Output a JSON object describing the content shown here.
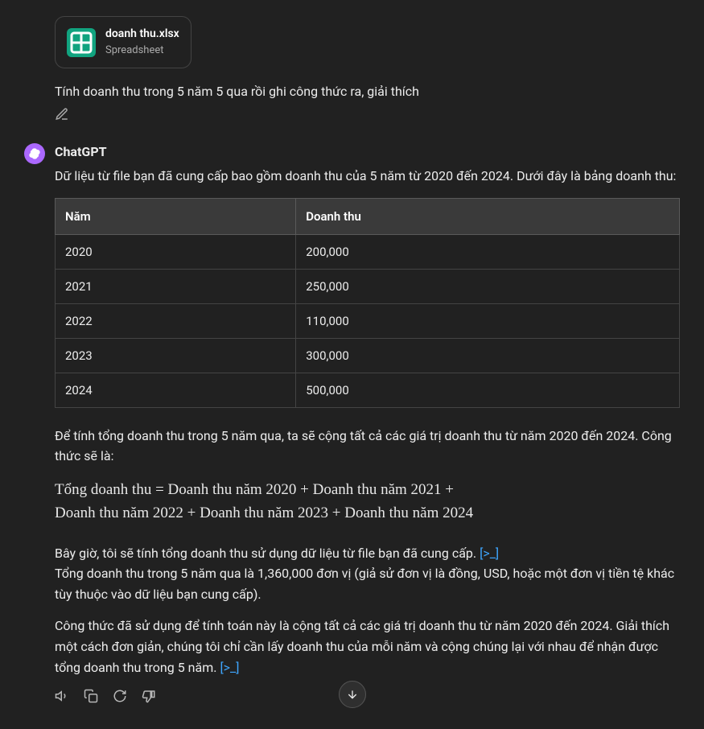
{
  "attachment": {
    "filename": "doanh thu.xlsx",
    "filetype": "Spreadsheet"
  },
  "user_prompt": "Tính doanh thu trong 5 năm 5 qua rồi ghi công thức ra, giải thích",
  "assistant": {
    "name": "ChatGPT",
    "intro": "Dữ liệu từ file bạn đã cung cấp bao gồm doanh thu của 5 năm từ 2020 đến 2024. Dưới đây là bảng doanh thu:",
    "table": {
      "headers": [
        "Năm",
        "Doanh thu"
      ],
      "rows": [
        [
          "2020",
          "200,000"
        ],
        [
          "2021",
          "250,000"
        ],
        [
          "2022",
          "110,000"
        ],
        [
          "2023",
          "300,000"
        ],
        [
          "2024",
          "500,000"
        ]
      ]
    },
    "formula_intro": "Để tính tổng doanh thu trong 5 năm qua, ta sẽ cộng tất cả các giá trị doanh thu từ năm 2020 đến 2024. Công thức sẽ là:",
    "formula_line1": "Tổng doanh thu = Doanh thu năm 2020 + Doanh thu năm 2021 +",
    "formula_line2": "Doanh thu năm 2022 + Doanh thu năm 2023 + Doanh thu năm 2024",
    "calc_now": "Bây giờ, tôi sẽ tính tổng doanh thu sử dụng dữ liệu từ file bạn đã cung cấp.",
    "code_link1": "[>_]",
    "result_line": "Tổng doanh thu trong 5 năm qua là 1,360,000 đơn vị (giả sử đơn vị là đồng, USD, hoặc một đơn vị tiền tệ khác tùy thuộc vào dữ liệu bạn cung cấp).",
    "explain": "Công thức đã sử dụng để tính toán này là cộng tất cả các giá trị doanh thu từ năm 2020 đến 2024. Giải thích một cách đơn giản, chúng tôi chỉ cần lấy doanh thu của mỗi năm và cộng chúng lại với nhau để nhận được tổng doanh thu trong 5 năm.",
    "code_link2": "[>_]"
  }
}
